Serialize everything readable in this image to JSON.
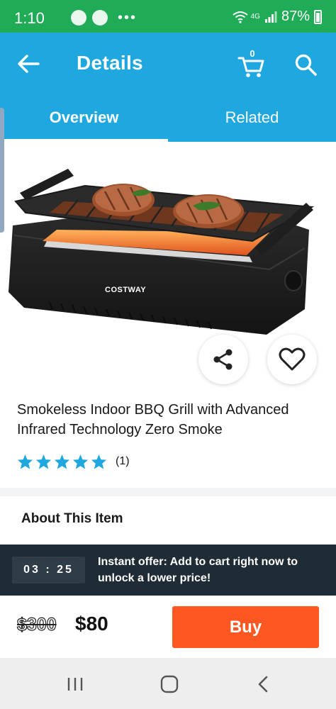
{
  "status_bar": {
    "time": "1:10",
    "network": "4G",
    "battery": "87%"
  },
  "app_bar": {
    "title": "Details",
    "cart_count": "0",
    "back_icon": "arrow-left-icon",
    "cart_icon": "shopping-cart-icon",
    "search_icon": "search-icon",
    "color": "#1fa7e0"
  },
  "tabs": [
    {
      "label": "Overview",
      "active": true
    },
    {
      "label": "Related",
      "active": false
    }
  ],
  "product": {
    "brand_on_image": "COSTWAY",
    "title": "Smokeless Indoor BBQ Grill with Advanced Infrared Technology Zero Smoke",
    "rating_stars": 5,
    "review_count": "(1)",
    "share_icon": "share-icon",
    "favorite_icon": "heart-outline-icon"
  },
  "about": {
    "heading": "About This Item"
  },
  "offer": {
    "countdown": "03 : 25",
    "text": "Instant offer: Add to cart right now to unlock a lower price!"
  },
  "pricing": {
    "original_price": "$300",
    "sale_price": "$80",
    "buy_label": "Buy",
    "buy_color": "#fe5722"
  },
  "nav_bar": {
    "recents_icon": "recents-icon",
    "home_icon": "home-icon",
    "back_icon": "back-chevron-icon"
  }
}
